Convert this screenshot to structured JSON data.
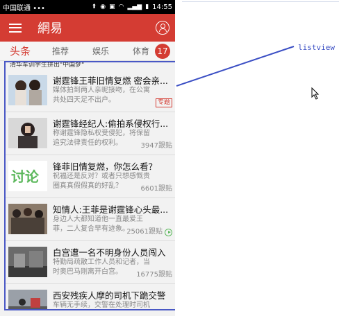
{
  "statusbar": {
    "carrier": "中国联通",
    "dots": "•••",
    "time": "14:55"
  },
  "appbar": {
    "title": "網易"
  },
  "tabs": [
    {
      "label": "头条",
      "active": true
    },
    {
      "label": "推荐",
      "active": false
    },
    {
      "label": "娱乐",
      "active": false
    },
    {
      "label": "体育",
      "active": false
    }
  ],
  "tab_badge": "17",
  "list_header": "清华军训学生拼出\"中国梦\"",
  "items": [
    {
      "title": "谢霆锋王菲旧情复燃 密会亲...",
      "summary": "媒体拍到两人亲昵接吻，在公寓共处四天足不出户。",
      "count": "",
      "tag": "专题",
      "thumb": "couple-photo-icon"
    },
    {
      "title": "谢霆锋经纪人:偷拍系侵权行...",
      "summary": "称谢霆锋隐私权受侵犯，将保留追究法律责任的权利。",
      "count": "3947跟贴",
      "tag": "",
      "thumb": "woman-photo-icon"
    },
    {
      "title": "锋菲旧情复燃，你怎么看？",
      "summary": "祝福还是反对？或者只想感慨贵圈真真假假真的好乱？",
      "count": "6601跟贴",
      "tag": "",
      "thumb": "taolun-logo-icon"
    },
    {
      "title": "知情人:王菲是谢霆锋心头最...",
      "summary": "身边人大都知道他一直最爱王菲，二人复合早有迹象。",
      "count": "25061跟贴",
      "tag": "",
      "thumb": "group-photo-icon",
      "play": true
    },
    {
      "title": "白宫遭一名不明身份人员闯入",
      "summary": "特勤局疏散工作人员和记者，当时奥巴马刚离开白宫。",
      "count": "16775跟贴",
      "tag": "",
      "thumb": "whitehouse-photo-icon"
    },
    {
      "title": "西安残疾人摩的司机下跪交警",
      "summary": "车辆无手续，交警在处理时司机下",
      "count": "",
      "tag": "",
      "thumb": "street-photo-icon"
    }
  ],
  "annotation": "listview",
  "colors": {
    "brand": "#d43c33",
    "highlight": "#4958c5"
  }
}
